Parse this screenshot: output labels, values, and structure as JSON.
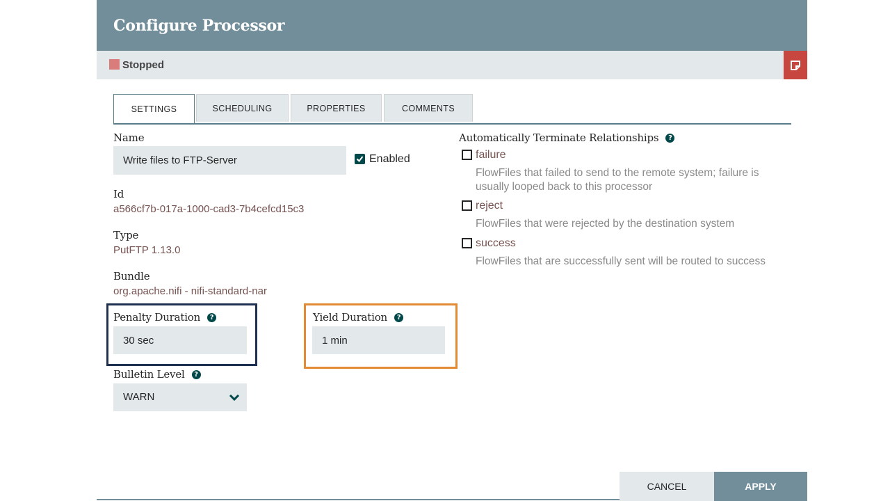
{
  "dialog": {
    "title": "Configure Processor"
  },
  "status": {
    "text": "Stopped",
    "color": "#d87c7c",
    "notes_icon": "sticky-note-icon"
  },
  "tabs": [
    {
      "label": "SETTINGS",
      "active": true
    },
    {
      "label": "SCHEDULING",
      "active": false
    },
    {
      "label": "PROPERTIES",
      "active": false
    },
    {
      "label": "COMMENTS",
      "active": false
    }
  ],
  "settings": {
    "name_label": "Name",
    "name_value": "Write files to FTP-Server",
    "enabled_label": "Enabled",
    "enabled_checked": true,
    "id_label": "Id",
    "id_value": "a566cf7b-017a-1000-cad3-7b4cefcd15c3",
    "type_label": "Type",
    "type_value": "PutFTP 1.13.0",
    "bundle_label": "Bundle",
    "bundle_value": "org.apache.nifi - nifi-standard-nar",
    "penalty_label": "Penalty Duration",
    "penalty_value": "30 sec",
    "yield_label": "Yield Duration",
    "yield_value": "1 min",
    "bulletin_label": "Bulletin Level",
    "bulletin_value": "WARN"
  },
  "relationships": {
    "label": "Automatically Terminate Relationships",
    "items": [
      {
        "name": "failure",
        "checked": false,
        "description": "FlowFiles that failed to send to the remote system; failure is usually looped back to this processor"
      },
      {
        "name": "reject",
        "checked": false,
        "description": "FlowFiles that were rejected by the destination system"
      },
      {
        "name": "success",
        "checked": false,
        "description": "FlowFiles that are successfully sent will be routed to success"
      }
    ]
  },
  "buttons": {
    "cancel": "CANCEL",
    "apply": "APPLY"
  },
  "colors": {
    "header": "#728e9b",
    "accent": "#004849",
    "value_text": "#775351",
    "notes_button": "#c7463f",
    "highlight_penalty": "#203050",
    "highlight_yield": "#e38a35"
  }
}
